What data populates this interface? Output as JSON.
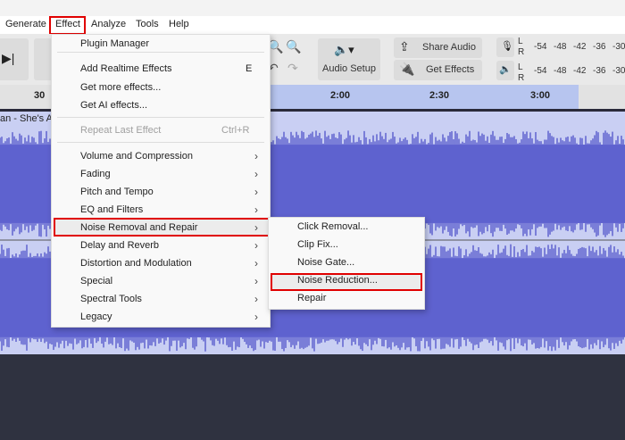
{
  "menubar": {
    "items": [
      "Generate",
      "Effect",
      "Analyze",
      "Tools",
      "Help"
    ]
  },
  "toolbar": {
    "audio_setup": "Audio Setup",
    "share_audio": "Share Audio",
    "get_effects": "Get Effects",
    "meter_labels": [
      "-54",
      "-48",
      "-42",
      "-36",
      "-30"
    ],
    "channel_l": "L",
    "channel_r": "R"
  },
  "ruler": {
    "ticks": [
      "30",
      "2:00",
      "2:30",
      "3:00"
    ]
  },
  "track": {
    "title": "an - She's A"
  },
  "effect_menu": {
    "plugin_manager": "Plugin Manager",
    "add_realtime": "Add Realtime Effects",
    "add_realtime_shortcut": "E",
    "get_more": "Get more effects...",
    "get_ai": "Get AI effects...",
    "repeat_last": "Repeat Last Effect",
    "repeat_last_shortcut": "Ctrl+R",
    "submenus": [
      "Volume and Compression",
      "Fading",
      "Pitch and Tempo",
      "EQ and Filters",
      "Noise Removal and Repair",
      "Delay and Reverb",
      "Distortion and Modulation",
      "Special",
      "Spectral Tools",
      "Legacy"
    ]
  },
  "noise_submenu": {
    "items": [
      "Click Removal...",
      "Clip Fix...",
      "Noise Gate...",
      "Noise Reduction...",
      "Repair"
    ],
    "highlighted": "Noise Reduction..."
  },
  "colors": {
    "waveform": "#5f62cf",
    "selection": "#b7c5ef",
    "highlight_border": "#e00000"
  }
}
